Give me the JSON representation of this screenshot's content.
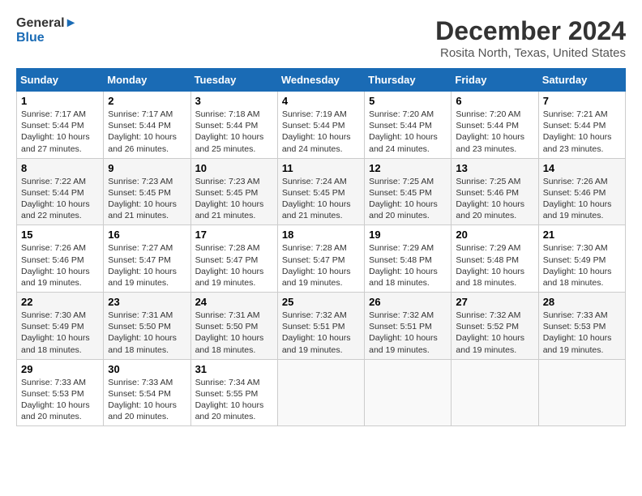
{
  "logo": {
    "line1": "General",
    "line2": "Blue"
  },
  "title": "December 2024",
  "location": "Rosita North, Texas, United States",
  "days_of_week": [
    "Sunday",
    "Monday",
    "Tuesday",
    "Wednesday",
    "Thursday",
    "Friday",
    "Saturday"
  ],
  "weeks": [
    [
      {
        "day": "1",
        "sunrise": "7:17 AM",
        "sunset": "5:44 PM",
        "daylight": "10 hours and 27 minutes."
      },
      {
        "day": "2",
        "sunrise": "7:17 AM",
        "sunset": "5:44 PM",
        "daylight": "10 hours and 26 minutes."
      },
      {
        "day": "3",
        "sunrise": "7:18 AM",
        "sunset": "5:44 PM",
        "daylight": "10 hours and 25 minutes."
      },
      {
        "day": "4",
        "sunrise": "7:19 AM",
        "sunset": "5:44 PM",
        "daylight": "10 hours and 24 minutes."
      },
      {
        "day": "5",
        "sunrise": "7:20 AM",
        "sunset": "5:44 PM",
        "daylight": "10 hours and 24 minutes."
      },
      {
        "day": "6",
        "sunrise": "7:20 AM",
        "sunset": "5:44 PM",
        "daylight": "10 hours and 23 minutes."
      },
      {
        "day": "7",
        "sunrise": "7:21 AM",
        "sunset": "5:44 PM",
        "daylight": "10 hours and 23 minutes."
      }
    ],
    [
      {
        "day": "8",
        "sunrise": "7:22 AM",
        "sunset": "5:44 PM",
        "daylight": "10 hours and 22 minutes."
      },
      {
        "day": "9",
        "sunrise": "7:23 AM",
        "sunset": "5:45 PM",
        "daylight": "10 hours and 21 minutes."
      },
      {
        "day": "10",
        "sunrise": "7:23 AM",
        "sunset": "5:45 PM",
        "daylight": "10 hours and 21 minutes."
      },
      {
        "day": "11",
        "sunrise": "7:24 AM",
        "sunset": "5:45 PM",
        "daylight": "10 hours and 21 minutes."
      },
      {
        "day": "12",
        "sunrise": "7:25 AM",
        "sunset": "5:45 PM",
        "daylight": "10 hours and 20 minutes."
      },
      {
        "day": "13",
        "sunrise": "7:25 AM",
        "sunset": "5:46 PM",
        "daylight": "10 hours and 20 minutes."
      },
      {
        "day": "14",
        "sunrise": "7:26 AM",
        "sunset": "5:46 PM",
        "daylight": "10 hours and 19 minutes."
      }
    ],
    [
      {
        "day": "15",
        "sunrise": "7:26 AM",
        "sunset": "5:46 PM",
        "daylight": "10 hours and 19 minutes."
      },
      {
        "day": "16",
        "sunrise": "7:27 AM",
        "sunset": "5:47 PM",
        "daylight": "10 hours and 19 minutes."
      },
      {
        "day": "17",
        "sunrise": "7:28 AM",
        "sunset": "5:47 PM",
        "daylight": "10 hours and 19 minutes."
      },
      {
        "day": "18",
        "sunrise": "7:28 AM",
        "sunset": "5:47 PM",
        "daylight": "10 hours and 19 minutes."
      },
      {
        "day": "19",
        "sunrise": "7:29 AM",
        "sunset": "5:48 PM",
        "daylight": "10 hours and 18 minutes."
      },
      {
        "day": "20",
        "sunrise": "7:29 AM",
        "sunset": "5:48 PM",
        "daylight": "10 hours and 18 minutes."
      },
      {
        "day": "21",
        "sunrise": "7:30 AM",
        "sunset": "5:49 PM",
        "daylight": "10 hours and 18 minutes."
      }
    ],
    [
      {
        "day": "22",
        "sunrise": "7:30 AM",
        "sunset": "5:49 PM",
        "daylight": "10 hours and 18 minutes."
      },
      {
        "day": "23",
        "sunrise": "7:31 AM",
        "sunset": "5:50 PM",
        "daylight": "10 hours and 18 minutes."
      },
      {
        "day": "24",
        "sunrise": "7:31 AM",
        "sunset": "5:50 PM",
        "daylight": "10 hours and 18 minutes."
      },
      {
        "day": "25",
        "sunrise": "7:32 AM",
        "sunset": "5:51 PM",
        "daylight": "10 hours and 19 minutes."
      },
      {
        "day": "26",
        "sunrise": "7:32 AM",
        "sunset": "5:51 PM",
        "daylight": "10 hours and 19 minutes."
      },
      {
        "day": "27",
        "sunrise": "7:32 AM",
        "sunset": "5:52 PM",
        "daylight": "10 hours and 19 minutes."
      },
      {
        "day": "28",
        "sunrise": "7:33 AM",
        "sunset": "5:53 PM",
        "daylight": "10 hours and 19 minutes."
      }
    ],
    [
      {
        "day": "29",
        "sunrise": "7:33 AM",
        "sunset": "5:53 PM",
        "daylight": "10 hours and 20 minutes."
      },
      {
        "day": "30",
        "sunrise": "7:33 AM",
        "sunset": "5:54 PM",
        "daylight": "10 hours and 20 minutes."
      },
      {
        "day": "31",
        "sunrise": "7:34 AM",
        "sunset": "5:55 PM",
        "daylight": "10 hours and 20 minutes."
      },
      null,
      null,
      null,
      null
    ]
  ]
}
